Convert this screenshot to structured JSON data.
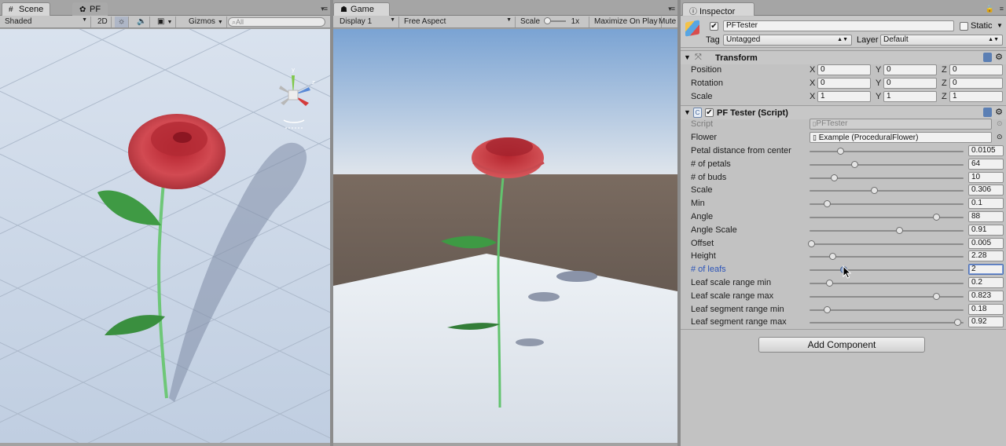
{
  "scene": {
    "tab": "Scene",
    "tab2": "PF",
    "shading": "Shaded",
    "mode2d": "2D",
    "gizmos": "Gizmos",
    "search_placeholder": "All",
    "axis_y": "y",
    "axis_z": "z"
  },
  "game": {
    "tab": "Game",
    "display": "Display 1",
    "aspect": "Free Aspect",
    "scale_label": "Scale",
    "scale_value": "1x",
    "maximize": "Maximize On Play",
    "mute": "Mute"
  },
  "inspector": {
    "tab": "Inspector",
    "object_name": "PFTester",
    "static_label": "Static",
    "tag_label": "Tag",
    "tag_value": "Untagged",
    "layer_label": "Layer",
    "layer_value": "Default",
    "transform": {
      "title": "Transform",
      "rows": [
        {
          "label": "Position",
          "x": "0",
          "y": "0",
          "z": "0"
        },
        {
          "label": "Rotation",
          "x": "0",
          "y": "0",
          "z": "0"
        },
        {
          "label": "Scale",
          "x": "1",
          "y": "1",
          "z": "1"
        }
      ],
      "axis_x": "X",
      "axis_y": "Y",
      "axis_z": "Z"
    },
    "script": {
      "title": "PF Tester (Script)",
      "script_label": "Script",
      "script_value": "PFTester",
      "flower_label": "Flower",
      "flower_value": "Example (ProceduralFlower)"
    },
    "sliders": [
      {
        "label": "Petal distance from center",
        "value": "0.0105",
        "fraction": 0.2
      },
      {
        "label": "# of petals",
        "value": "64",
        "fraction": 0.29
      },
      {
        "label": "# of buds",
        "value": "10",
        "fraction": 0.16
      },
      {
        "label": "Scale",
        "value": "0.306",
        "fraction": 0.42
      },
      {
        "label": "Min",
        "value": "0.1",
        "fraction": 0.11
      },
      {
        "label": "Angle",
        "value": "88",
        "fraction": 0.82
      },
      {
        "label": "Angle Scale",
        "value": "0.91",
        "fraction": 0.58
      },
      {
        "label": "Offset",
        "value": "0.005",
        "fraction": 0.01
      },
      {
        "label": "Height",
        "value": "2.28",
        "fraction": 0.15
      },
      {
        "label": "# of leafs",
        "value": "2",
        "fraction": 0.22,
        "active": true
      },
      {
        "label": "Leaf scale range min",
        "value": "0.2",
        "fraction": 0.13
      },
      {
        "label": "Leaf scale range max",
        "value": "0.823",
        "fraction": 0.82
      },
      {
        "label": "Leaf segment range min",
        "value": "0.18",
        "fraction": 0.11
      },
      {
        "label": "Leaf segment range max",
        "value": "0.92",
        "fraction": 0.96
      }
    ],
    "add_component": "Add Component"
  },
  "colors": {
    "active_label": "#2d55b8",
    "rose": "#c9383f",
    "leaf": "#3e9a42"
  }
}
